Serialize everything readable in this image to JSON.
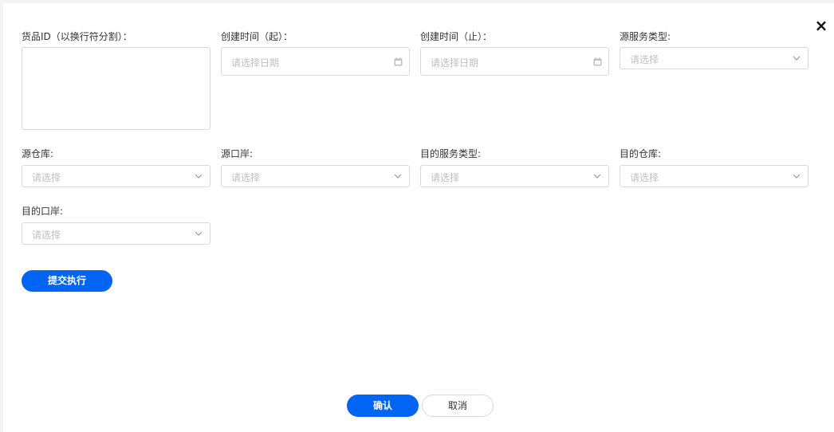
{
  "dialog": {
    "close_glyph": "×"
  },
  "form": {
    "item_ids": {
      "label": "货品ID（以换行符分割）：",
      "value": ""
    },
    "created_from": {
      "label": "创建时间（起）：",
      "placeholder": "请选择日期"
    },
    "created_to": {
      "label": "创建时间（止）：",
      "placeholder": "请选择日期"
    },
    "source_service_type": {
      "label": "源服务类型:",
      "placeholder": "请选择"
    },
    "source_warehouse": {
      "label": "源仓库:",
      "placeholder": "请选择"
    },
    "source_port": {
      "label": "源口岸:",
      "placeholder": "请选择"
    },
    "dest_service_type": {
      "label": "目的服务类型:",
      "placeholder": "请选择"
    },
    "dest_warehouse": {
      "label": "目的仓库:",
      "placeholder": "请选择"
    },
    "dest_port": {
      "label": "目的口岸:",
      "placeholder": "请选择"
    }
  },
  "actions": {
    "submit_execute": "提交执行",
    "confirm": "确认",
    "cancel": "取消"
  },
  "colors": {
    "primary": "#0065f2",
    "border": "#d9d9d9",
    "placeholder": "#bfbfbf"
  }
}
